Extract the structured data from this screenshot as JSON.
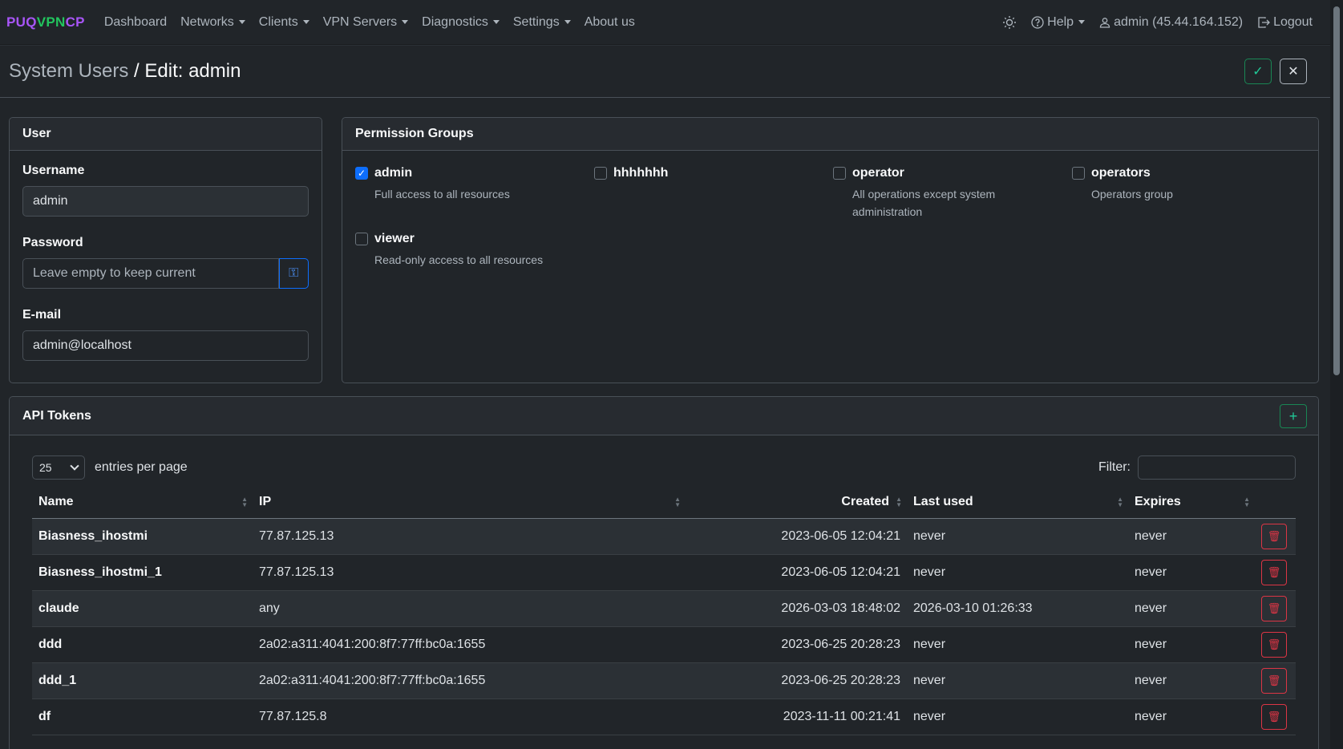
{
  "brand": {
    "part1": "PUQ",
    "part2": "VPN",
    "part3": "CP"
  },
  "nav": {
    "items": [
      {
        "label": "Dashboard",
        "dropdown": false
      },
      {
        "label": "Networks",
        "dropdown": true
      },
      {
        "label": "Clients",
        "dropdown": true
      },
      {
        "label": "VPN Servers",
        "dropdown": true
      },
      {
        "label": "Diagnostics",
        "dropdown": true
      },
      {
        "label": "Settings",
        "dropdown": true
      },
      {
        "label": "About us",
        "dropdown": false
      }
    ],
    "help": "Help",
    "user": "admin (45.44.164.152)",
    "logout": "Logout"
  },
  "header": {
    "crumb": "System Users",
    "sep": " / ",
    "current": "Edit: admin"
  },
  "user_card": {
    "title": "User",
    "username_label": "Username",
    "username_value": "admin",
    "password_label": "Password",
    "password_placeholder": "Leave empty to keep current",
    "email_label": "E-mail",
    "email_value": "admin@localhost"
  },
  "permissions": {
    "title": "Permission Groups",
    "groups": [
      {
        "name": "admin",
        "desc": "Full access to all resources",
        "checked": true
      },
      {
        "name": "hhhhhhh",
        "desc": "",
        "checked": false
      },
      {
        "name": "operator",
        "desc": "All operations except system administration",
        "checked": false
      },
      {
        "name": "operators",
        "desc": "Operators group",
        "checked": false
      },
      {
        "name": "viewer",
        "desc": "Read-only access to all resources",
        "checked": false
      }
    ]
  },
  "tokens": {
    "title": "API Tokens",
    "page_size": "25",
    "entries_label": "entries per page",
    "filter_label": "Filter:",
    "columns": [
      "Name",
      "IP",
      "Created",
      "Last used",
      "Expires"
    ],
    "rows": [
      {
        "name": "Biasness_ihostmi",
        "ip": "77.87.125.13",
        "created": "2023-06-05 12:04:21",
        "last_used": "never",
        "expires": "never"
      },
      {
        "name": "Biasness_ihostmi_1",
        "ip": "77.87.125.13",
        "created": "2023-06-05 12:04:21",
        "last_used": "never",
        "expires": "never"
      },
      {
        "name": "claude",
        "ip": "any",
        "created": "2026-03-03 18:48:02",
        "last_used": "2026-03-10 01:26:33",
        "expires": "never"
      },
      {
        "name": "ddd",
        "ip": "2a02:a311:4041:200:8f7:77ff:bc0a:1655",
        "created": "2023-06-25 20:28:23",
        "last_used": "never",
        "expires": "never"
      },
      {
        "name": "ddd_1",
        "ip": "2a02:a311:4041:200:8f7:77ff:bc0a:1655",
        "created": "2023-06-25 20:28:23",
        "last_used": "never",
        "expires": "never"
      },
      {
        "name": "df",
        "ip": "77.87.125.8",
        "created": "2023-11-11 00:21:41",
        "last_used": "never",
        "expires": "never"
      }
    ]
  }
}
